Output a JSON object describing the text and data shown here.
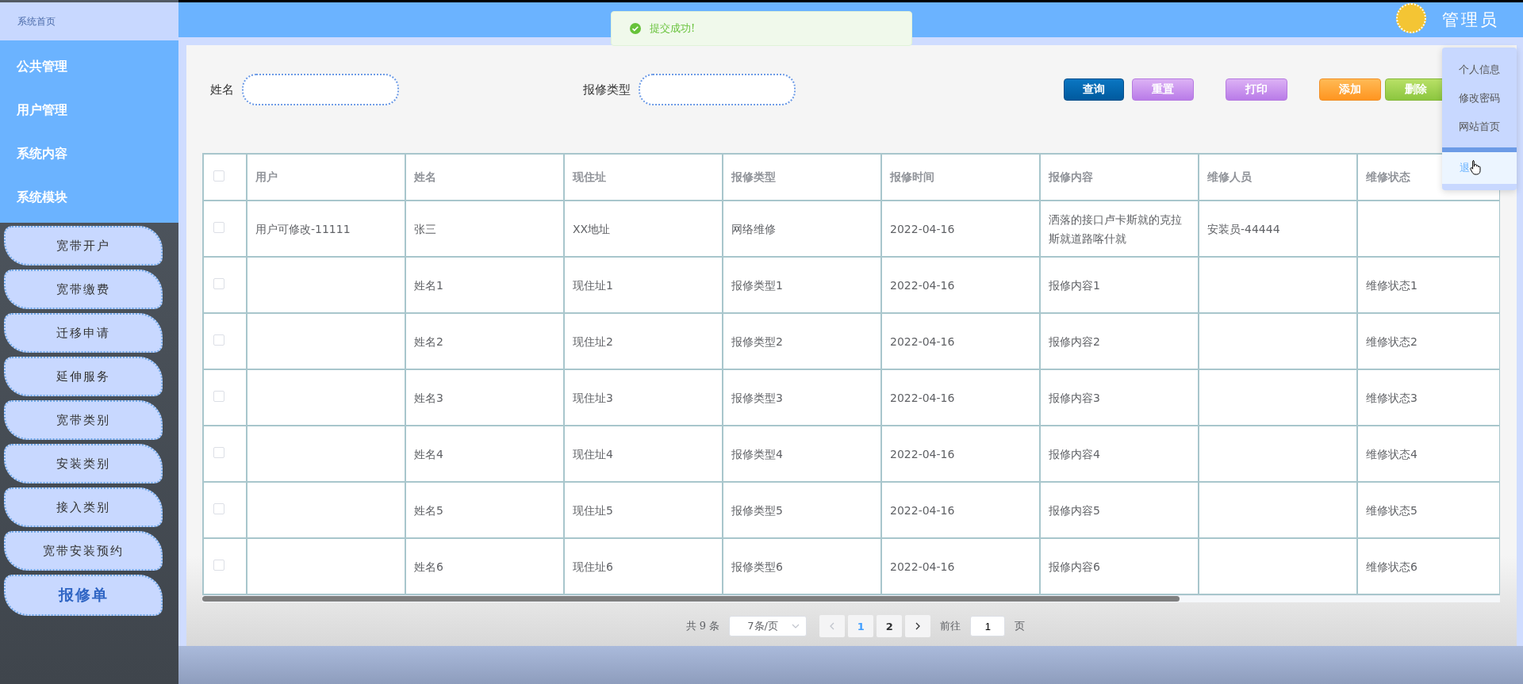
{
  "sidebar": {
    "home": "系统首页",
    "groups": [
      {
        "label": "公共管理"
      },
      {
        "label": "用户管理"
      },
      {
        "label": "系统内容"
      },
      {
        "label": "系统模块"
      }
    ],
    "items": [
      {
        "label": "宽带开户",
        "selected": false
      },
      {
        "label": "宽带缴费",
        "selected": false
      },
      {
        "label": "迁移申请",
        "selected": false
      },
      {
        "label": "延伸服务",
        "selected": false
      },
      {
        "label": "宽带类别",
        "selected": false
      },
      {
        "label": "安装类别",
        "selected": false
      },
      {
        "label": "接入类别",
        "selected": false
      },
      {
        "label": "宽带安装预约",
        "selected": false
      },
      {
        "label": "报修单",
        "selected": true
      }
    ]
  },
  "header": {
    "user": "管理员"
  },
  "toast": {
    "message": "提交成功!"
  },
  "search": {
    "fields": [
      {
        "label": "姓名"
      },
      {
        "label": "报修类型"
      }
    ],
    "buttons": [
      {
        "label": "查询",
        "kind": "query"
      },
      {
        "label": "重置",
        "kind": "purple"
      },
      {
        "label": "打印",
        "kind": "purple"
      },
      {
        "label": "添加",
        "kind": "orange"
      },
      {
        "label": "删除",
        "kind": "green"
      }
    ]
  },
  "user_menu": {
    "items": [
      {
        "label": "个人信息",
        "highlighted": false
      },
      {
        "label": "修改密码",
        "highlighted": false
      },
      {
        "label": "网站首页",
        "highlighted": false
      },
      {
        "label": "退",
        "highlighted": true
      }
    ]
  },
  "table": {
    "all_checked": false,
    "columns": [
      "用户",
      "姓名",
      "现住址",
      "报修类型",
      "报修时间",
      "报修内容",
      "维修人员",
      "维修状态"
    ],
    "rows": [
      {
        "checked": false,
        "cells": [
          "用户可修改-11111",
          "张三",
          "XX地址",
          "网络维修",
          "2022-04-16",
          "洒落的接口卢卡斯就的克拉斯就道路喀什就",
          "安装员-44444",
          ""
        ]
      },
      {
        "checked": false,
        "cells": [
          "",
          "姓名1",
          "现住址1",
          "报修类型1",
          "2022-04-16",
          "报修内容1",
          "",
          "维修状态1"
        ]
      },
      {
        "checked": false,
        "cells": [
          "",
          "姓名2",
          "现住址2",
          "报修类型2",
          "2022-04-16",
          "报修内容2",
          "",
          "维修状态2"
        ]
      },
      {
        "checked": false,
        "cells": [
          "",
          "姓名3",
          "现住址3",
          "报修类型3",
          "2022-04-16",
          "报修内容3",
          "",
          "维修状态3"
        ]
      },
      {
        "checked": false,
        "cells": [
          "",
          "姓名4",
          "现住址4",
          "报修类型4",
          "2022-04-16",
          "报修内容4",
          "",
          "维修状态4"
        ]
      },
      {
        "checked": false,
        "cells": [
          "",
          "姓名5",
          "现住址5",
          "报修类型5",
          "2022-04-16",
          "报修内容5",
          "",
          "维修状态5"
        ]
      },
      {
        "checked": false,
        "cells": [
          "",
          "姓名6",
          "现住址6",
          "报修类型6",
          "2022-04-16",
          "报修内容6",
          "",
          "维修状态6"
        ]
      }
    ]
  },
  "pagination": {
    "total": "共 9 条",
    "page_size": "7条/页",
    "prev_disabled": true,
    "pages": [
      {
        "label": "1",
        "selected": true
      },
      {
        "label": "2",
        "selected": false
      }
    ],
    "goto_label": "前往",
    "goto_value": "1",
    "goto_suffix": "页"
  }
}
